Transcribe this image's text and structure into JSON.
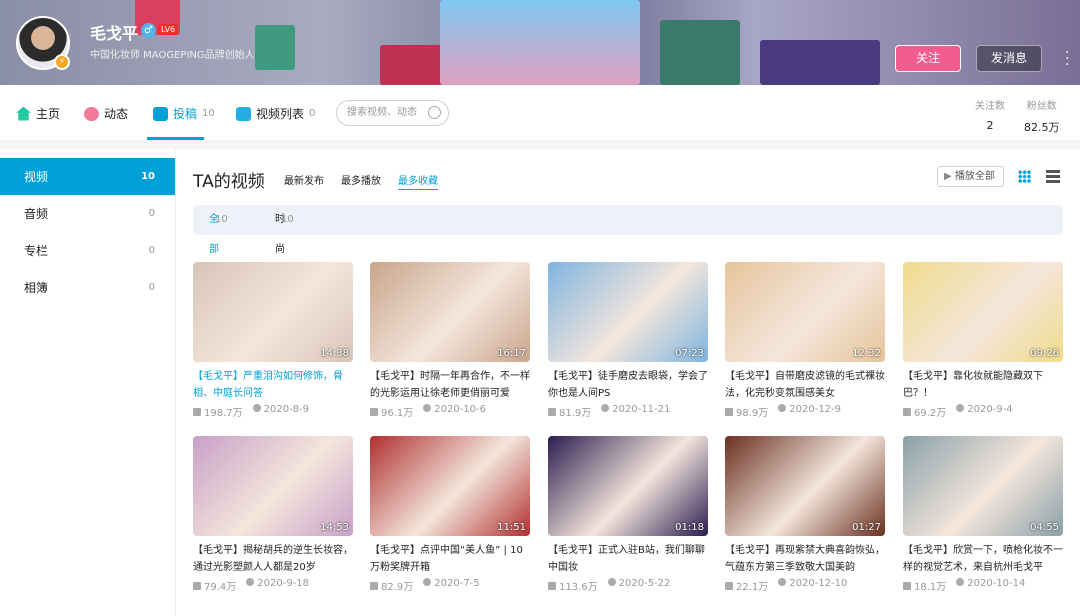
{
  "profile": {
    "name": "毛戈平",
    "level": "LV6",
    "sign": "中国化妆师 MAOGEPING品牌创始人",
    "follow_label": "关注",
    "message_label": "发消息"
  },
  "nav": {
    "items": [
      {
        "label": "主页",
        "count": ""
      },
      {
        "label": "动态",
        "count": ""
      },
      {
        "label": "投稿",
        "count": "10"
      },
      {
        "label": "视频列表",
        "count": "0"
      }
    ],
    "search_placeholder": "搜索视频、动态",
    "following_label": "关注数",
    "following": "2",
    "fans_label": "粉丝数",
    "fans": "82.5万"
  },
  "sidebar": {
    "items": [
      {
        "label": "视频",
        "count": "10"
      },
      {
        "label": "音频",
        "count": "0"
      },
      {
        "label": "专栏",
        "count": "0"
      },
      {
        "label": "相簿",
        "count": "0"
      }
    ]
  },
  "main": {
    "title": "TA的视频",
    "sorts": [
      "最新发布",
      "最多播放",
      "最多收藏"
    ],
    "active_sort": "最多收藏",
    "play_all": "播放全部",
    "filters": [
      {
        "label": "全部",
        "count": "10"
      },
      {
        "label": "时尚",
        "count": "10"
      }
    ],
    "videos": [
      {
        "title": "【毛戈平】严重泪沟如何修饰，骨相、中庭长问答",
        "plays": "198.7万",
        "date": "2020-8-9",
        "duration": "14:38",
        "color": "#d8c4b8"
      },
      {
        "title": "【毛戈平】时隔一年再合作，不一样的光影运用让徐老师更俏丽可爱",
        "plays": "96.1万",
        "date": "2020-10-6",
        "duration": "16:17",
        "color": "#c9a58c"
      },
      {
        "title": "【毛戈平】徒手磨皮去眼袋，学会了你也是人间PS",
        "plays": "81.9万",
        "date": "2020-11-21",
        "duration": "07:23",
        "color": "#7fb4e0"
      },
      {
        "title": "【毛戈平】自带磨皮滤镜的毛式裸妆法，化完秒变氛围感美女",
        "plays": "98.9万",
        "date": "2020-12-9",
        "duration": "12:32",
        "color": "#e6c49a"
      },
      {
        "title": "【毛戈平】靠化妆就能隐藏双下巴？！",
        "plays": "69.2万",
        "date": "2020-9-4",
        "duration": "09:26",
        "color": "#f0dc8c"
      },
      {
        "title": "【毛戈平】揭秘胡兵的逆生长妆容，通过光影塑颜人人都是20岁",
        "plays": "79.4万",
        "date": "2020-9-18",
        "duration": "14:53",
        "color": "#c8a0c8"
      },
      {
        "title": "【毛戈平】点评中国“美人鱼” | 10万粉奖牌开箱",
        "plays": "82.9万",
        "date": "2020-7-5",
        "duration": "11:51",
        "color": "#b03030"
      },
      {
        "title": "【毛戈平】正式入驻B站，我们聊聊中国妆",
        "plays": "113.6万",
        "date": "2020-5-22",
        "duration": "01:18",
        "color": "#2a1d50"
      },
      {
        "title": "【毛戈平】再现紫禁大典喜韵恢弘，气蕴东方第三季致敬大国美韵",
        "plays": "22.1万",
        "date": "2020-12-10",
        "duration": "01:27",
        "color": "#6a3020"
      },
      {
        "title": "【毛戈平】欣赏一下，喷枪化妆不一样的视觉艺术，来自杭州毛戈平",
        "plays": "18.1万",
        "date": "2020-10-14",
        "duration": "04:55",
        "color": "#8aa0a8"
      }
    ]
  },
  "colors": {
    "accent": "#00a1d6",
    "follow": "#f25d8e"
  }
}
